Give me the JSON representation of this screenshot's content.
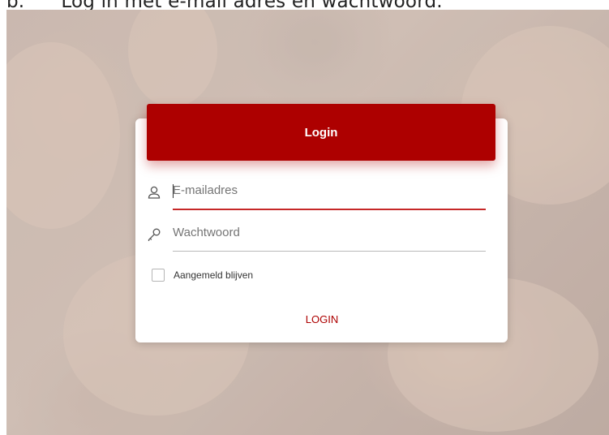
{
  "document": {
    "caption": "b.      Log in met e-mail adres en wachtwoord."
  },
  "login_card": {
    "title": "Login",
    "email": {
      "placeholder": "E-mailadres",
      "value": "",
      "icon": "user-icon"
    },
    "password": {
      "placeholder": "Wachtwoord",
      "value": "",
      "icon": "key-icon"
    },
    "remember_me": {
      "label": "Aangemeld blijven",
      "checked": false
    },
    "submit_label": "LOGIN"
  },
  "colors": {
    "accent": "#ad0000",
    "active_underline": "#c62828"
  }
}
